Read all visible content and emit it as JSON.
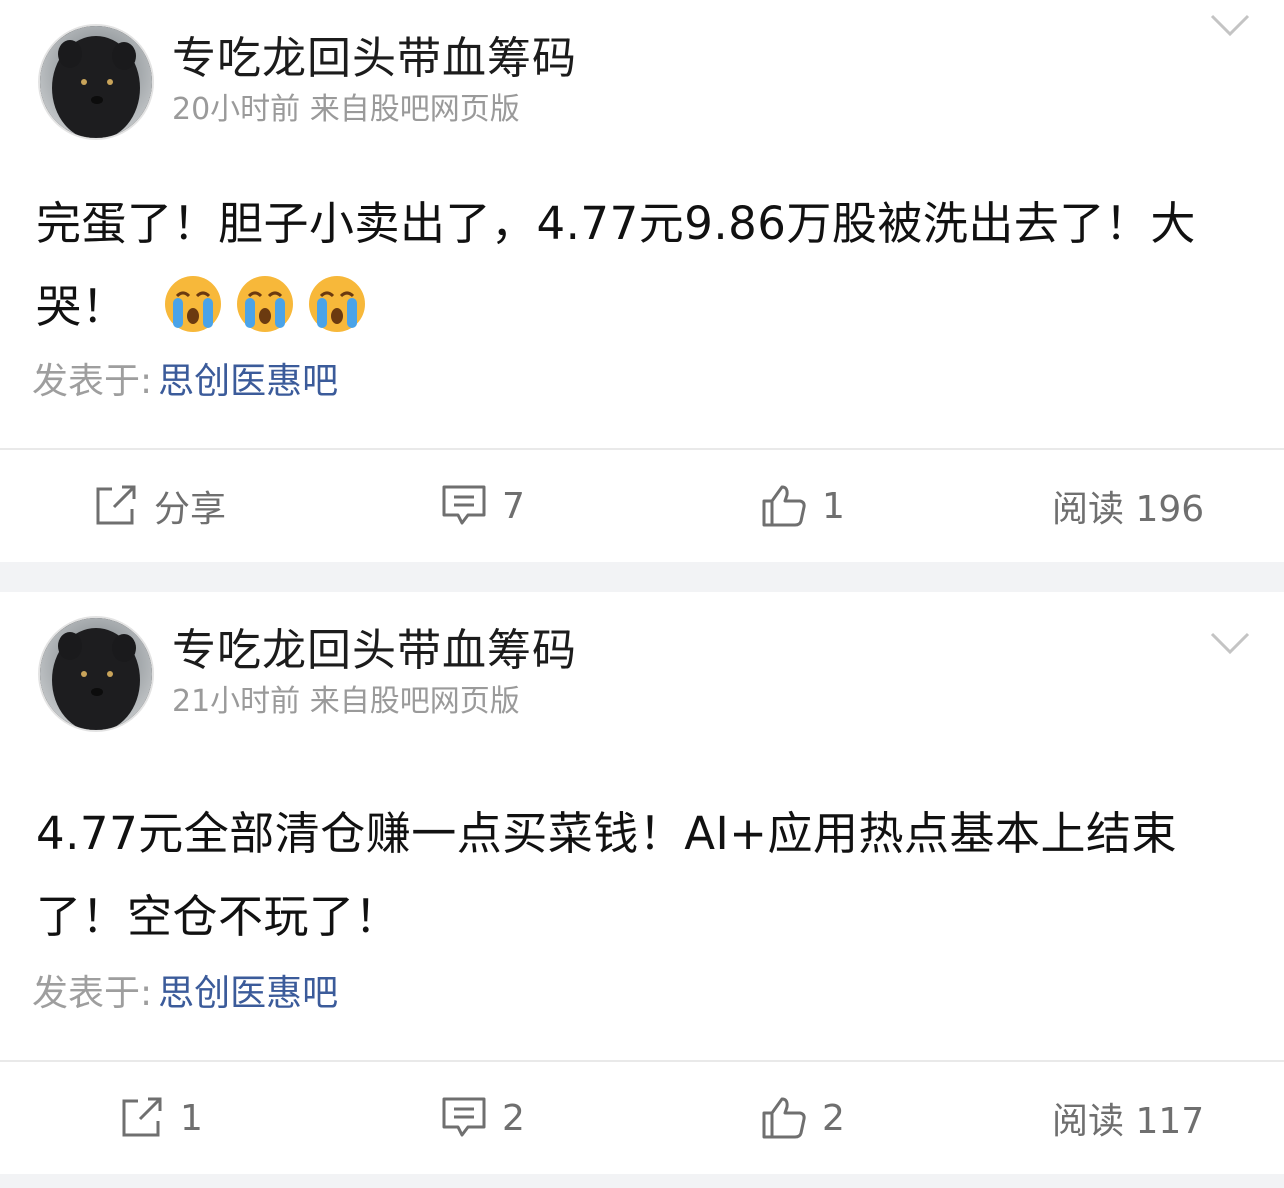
{
  "posts": [
    {
      "author": "专吃龙回头带血筹码",
      "meta": "20小时前 来自股吧网页版",
      "content": "完蛋了！胆子小卖出了，4.77元9.86万股被洗出去了！大哭！",
      "emojis": [
        "crying-emoji",
        "crying-emoji",
        "crying-emoji"
      ],
      "board_label": "发表于:",
      "board_name": "思创医惠吧",
      "share": "分享",
      "comments": "7",
      "likes": "1",
      "reads": "阅读 196"
    },
    {
      "author": "专吃龙回头带血筹码",
      "meta": "21小时前 来自股吧网页版",
      "content": "4.77元全部清仓赚一点买菜钱！AI+应用热点基本上结束了！空仓不玩了！",
      "board_label": "发表于:",
      "board_name": "思创医惠吧",
      "share": "1",
      "comments": "2",
      "likes": "2",
      "reads": "阅读 117"
    }
  ],
  "colors": {
    "text": "#111111",
    "meta": "#9a9a9a",
    "link": "#3b5b9a",
    "icon": "#6f6f6f",
    "separator": "#f2f3f5"
  },
  "icons": {
    "share": "share-icon",
    "comment": "comment-icon",
    "like": "thumbs-up-icon",
    "menu": "chevron-down-icon"
  }
}
